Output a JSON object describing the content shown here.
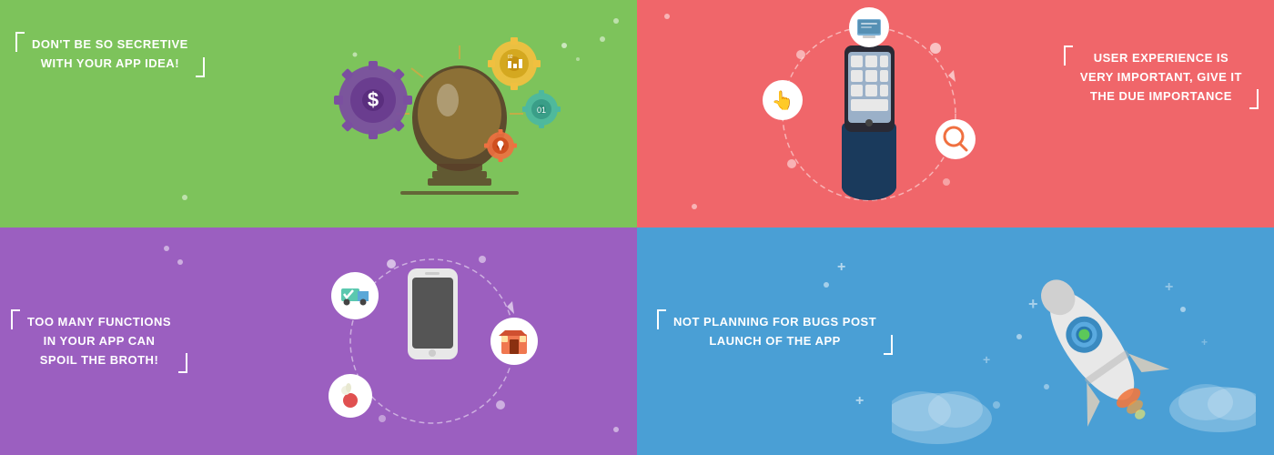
{
  "panels": [
    {
      "id": "panel-1",
      "bg": "#7dc35b",
      "text_line1": "DON'T BE SO SECRETIVE",
      "text_line2": "WITH YOUR APP IDEA!",
      "text_position": "top-left"
    },
    {
      "id": "panel-2",
      "bg": "#f0666a",
      "text_line1": "USER EXPERIENCE IS",
      "text_line2": "VERY IMPORTANT, GIVE IT",
      "text_line3": "THE DUE IMPORTANCE",
      "text_position": "top-right"
    },
    {
      "id": "panel-3",
      "bg": "#9b5fc0",
      "text_line1": "TOO MANY FUNCTIONS",
      "text_line2": "IN YOUR APP CAN",
      "text_line3": "SPOIL THE BROTH!",
      "text_position": "top-left"
    },
    {
      "id": "panel-4",
      "bg": "#4a9fd5",
      "text_line1": "NOT PLANNING FOR  BUGS POST",
      "text_line2": "LAUNCH OF THE APP",
      "text_position": "top-left"
    }
  ]
}
